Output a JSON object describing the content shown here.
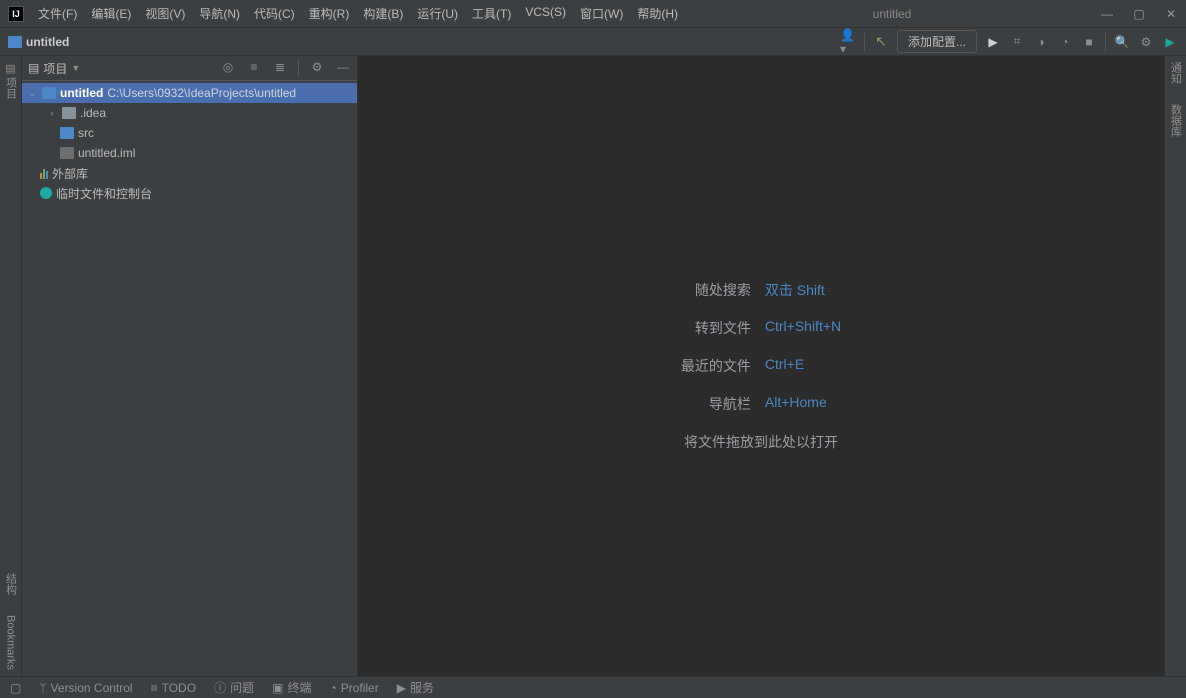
{
  "title": "untitled",
  "menu": [
    "文件(F)",
    "编辑(E)",
    "视图(V)",
    "导航(N)",
    "代码(C)",
    "重构(R)",
    "构建(B)",
    "运行(U)",
    "工具(T)",
    "VCS(S)",
    "窗口(W)",
    "帮助(H)"
  ],
  "nav": {
    "project_name": "untitled"
  },
  "runconfig": {
    "label": "添加配置..."
  },
  "project_panel": {
    "title": "项目",
    "root": {
      "name": "untitled",
      "path": "C:\\Users\\0932\\IdeaProjects\\untitled"
    },
    "children": [
      {
        "name": ".idea",
        "type": "folder"
      },
      {
        "name": "src",
        "type": "folder-blue"
      },
      {
        "name": "untitled.iml",
        "type": "iml"
      }
    ],
    "extra": [
      {
        "name": "外部库",
        "icon": "bars"
      },
      {
        "name": "临时文件和控制台",
        "icon": "globe"
      }
    ]
  },
  "tips": [
    {
      "label": "随处搜索",
      "shortcut": "双击 Shift"
    },
    {
      "label": "转到文件",
      "shortcut": "Ctrl+Shift+N"
    },
    {
      "label": "最近的文件",
      "shortcut": "Ctrl+E"
    },
    {
      "label": "导航栏",
      "shortcut": "Alt+Home"
    }
  ],
  "tips_drag": "将文件拖放到此处以打开",
  "left_gutter": {
    "project": "项目",
    "structure": "结构",
    "bookmarks": "Bookmarks"
  },
  "right_gutter": {
    "notifications": "通知",
    "db": "数据库"
  },
  "status": {
    "vcs": "Version Control",
    "todo": "TODO",
    "problems": "问题",
    "terminal": "终端",
    "profiler": "Profiler",
    "services": "服务"
  }
}
